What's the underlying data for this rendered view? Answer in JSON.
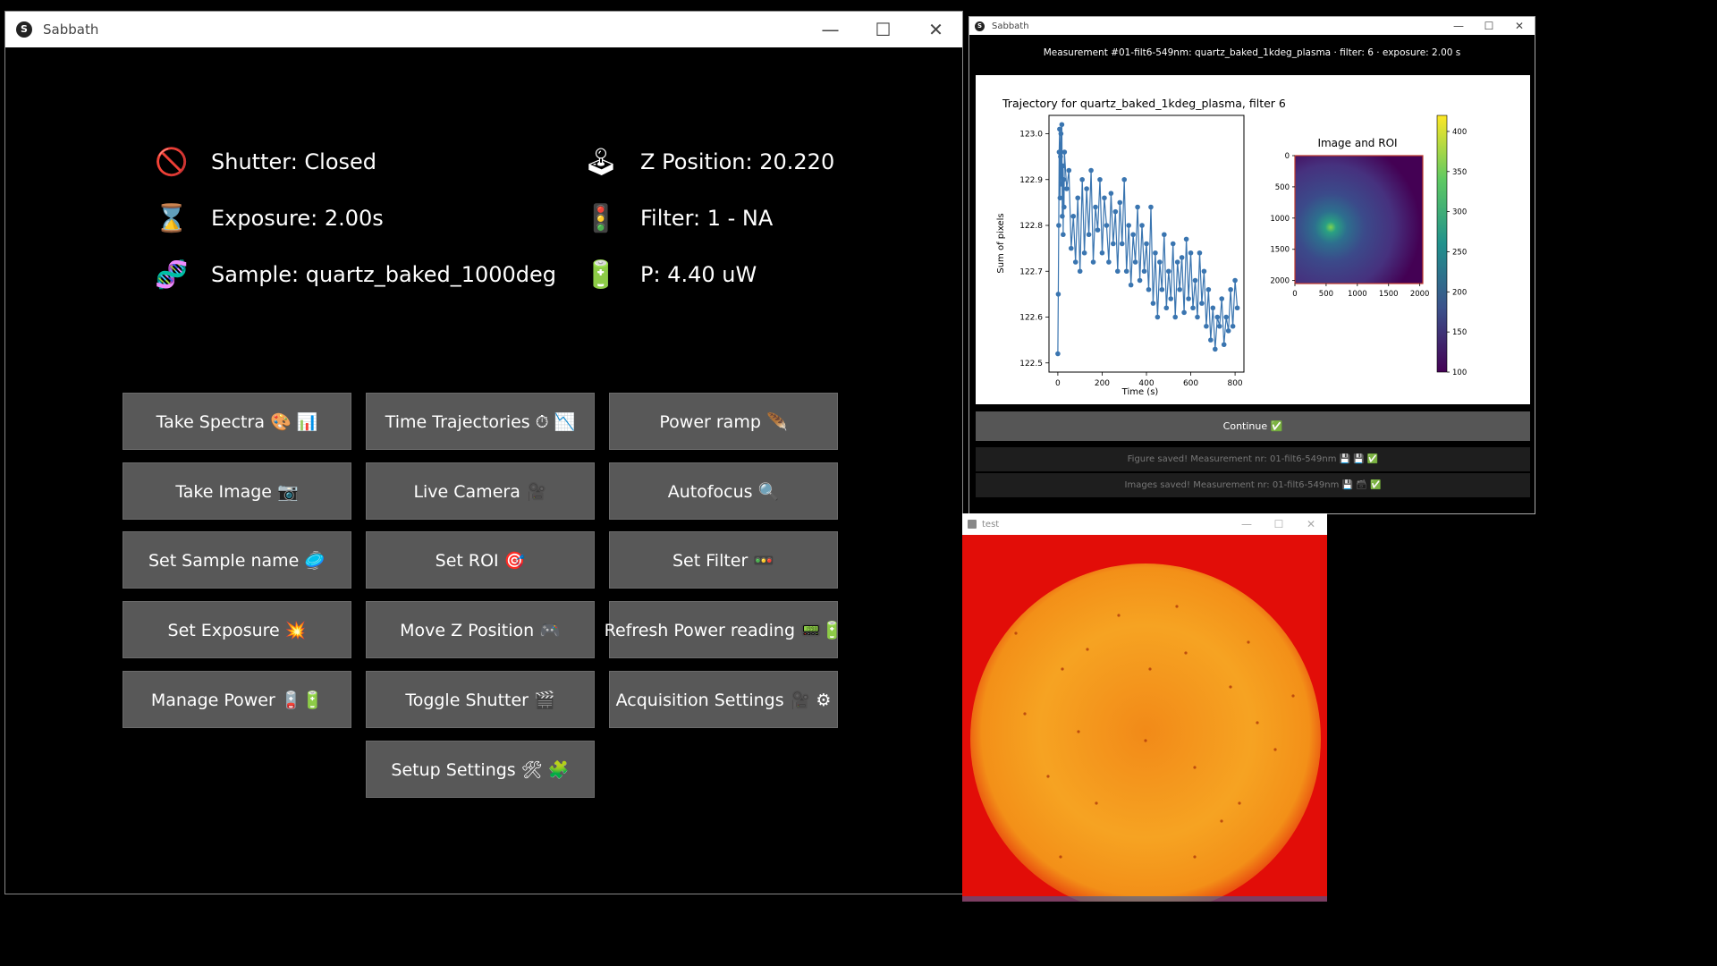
{
  "main": {
    "title": "Sabbath",
    "controls": [
      "—",
      "☐",
      "✕"
    ],
    "status": {
      "shutter": {
        "icon": "no-entry-icon",
        "glyph": "🚫",
        "text": "Shutter: Closed"
      },
      "exposure": {
        "icon": "hourglass-icon",
        "glyph": "⌛",
        "text": "Exposure: 2.00s"
      },
      "sample": {
        "icon": "dna-icon",
        "glyph": "🧬",
        "text": "Sample: quartz_baked_1000deg"
      },
      "zpos": {
        "icon": "joystick-icon",
        "glyph": "🕹",
        "text": "Z Position: 20.220"
      },
      "filter": {
        "icon": "traffic-light-icon",
        "glyph": "🚦",
        "text": "Filter: 1 - NA"
      },
      "power": {
        "icon": "battery-icon",
        "glyph": "🔋",
        "text": "P: 4.40 uW"
      }
    },
    "buttons": [
      "Take Spectra 🎨 📊",
      "Time Trajectories ⏱ 📉",
      "Power ramp 🪶",
      "Take Image 📷",
      "Live Camera 🎥",
      "Autofocus 🔍",
      "Set Sample name 🥏",
      "Set ROI 🎯",
      "Set Filter 🚥",
      "Set Exposure 💥",
      "Move Z Position 🎮",
      "Refresh Power reading 📟🔋",
      "Manage Power 🪫🔋",
      "Toggle Shutter 🎬",
      "Acquisition Settings 🎥 ⚙",
      "Setup Settings 🛠 🧩"
    ]
  },
  "plot": {
    "title": "Sabbath",
    "controls": [
      "—",
      "☐",
      "✕"
    ],
    "measurement": "Measurement #01-filt6-549nm: quartz_baked_1kdeg_plasma · filter: 6 · exposure: 2.00 s",
    "continue_label": "Continue ✅",
    "saved": [
      "Figure saved! Measurement nr: 01-filt6-549nm 💾 💾 ✅",
      "Images saved! Measurement nr: 01-filt6-549nm 💾 🗃 ✅"
    ]
  },
  "chart_data": [
    {
      "type": "line",
      "title": "Trajectory for quartz_baked_1kdeg_plasma, filter 6",
      "xlabel": "Time (s)",
      "ylabel": "Sum of pixels",
      "xlim": [
        -40,
        840
      ],
      "ylim": [
        122.48,
        123.04
      ],
      "xticks": [
        0,
        200,
        400,
        600,
        800
      ],
      "yticks": [
        122.5,
        122.6,
        122.7,
        122.8,
        122.9,
        123.0
      ],
      "ytick_labels": [
        "122.5",
        "122.6",
        "122.7",
        "122.8",
        "122.9",
        "123.0"
      ],
      "color": "#3a75b0",
      "x": [
        0,
        2,
        4,
        6,
        8,
        10,
        12,
        14,
        16,
        18,
        20,
        22,
        24,
        26,
        28,
        30,
        40,
        50,
        60,
        70,
        80,
        90,
        100,
        110,
        120,
        130,
        140,
        150,
        160,
        170,
        180,
        190,
        200,
        210,
        220,
        230,
        240,
        250,
        260,
        270,
        280,
        290,
        300,
        310,
        320,
        330,
        340,
        350,
        360,
        370,
        380,
        390,
        400,
        410,
        420,
        430,
        440,
        450,
        460,
        470,
        480,
        490,
        500,
        510,
        520,
        530,
        540,
        550,
        560,
        570,
        580,
        590,
        600,
        610,
        620,
        630,
        640,
        650,
        660,
        670,
        680,
        690,
        700,
        710,
        720,
        730,
        740,
        750,
        760,
        770,
        780,
        790,
        800,
        810
      ],
      "y": [
        122.52,
        122.65,
        122.8,
        122.96,
        123.01,
        122.86,
        122.95,
        123.0,
        122.89,
        123.02,
        122.82,
        122.93,
        122.78,
        122.9,
        122.84,
        122.96,
        122.88,
        122.92,
        122.75,
        122.82,
        122.72,
        122.86,
        122.7,
        122.9,
        122.74,
        122.88,
        122.78,
        122.92,
        122.72,
        122.84,
        122.79,
        122.9,
        122.74,
        122.86,
        122.8,
        122.72,
        122.87,
        122.76,
        122.83,
        122.7,
        122.85,
        122.76,
        122.9,
        122.7,
        122.8,
        122.67,
        122.78,
        122.72,
        122.84,
        122.68,
        122.8,
        122.7,
        122.76,
        122.66,
        122.84,
        122.63,
        122.74,
        122.6,
        122.72,
        122.66,
        122.78,
        122.62,
        122.7,
        122.64,
        122.76,
        122.6,
        122.72,
        122.66,
        122.73,
        122.61,
        122.77,
        122.64,
        122.74,
        122.62,
        122.68,
        122.6,
        122.74,
        122.63,
        122.7,
        122.58,
        122.66,
        122.55,
        122.62,
        122.53,
        122.6,
        122.58,
        122.64,
        122.54,
        122.6,
        122.57,
        122.66,
        122.58,
        122.68,
        122.62
      ]
    },
    {
      "type": "heatmap",
      "title": "Image and ROI",
      "xticks": [
        0,
        500,
        1000,
        1500,
        2000
      ],
      "yticks": [
        0,
        500,
        1000,
        1500,
        2000
      ],
      "xlim": [
        0,
        2048
      ],
      "ylim": [
        2048,
        0
      ],
      "colorbar_ticks": [
        100,
        150,
        200,
        250,
        300,
        350,
        400
      ],
      "colorbar_range": [
        100,
        420
      ],
      "roi_color": "#c0392b"
    }
  ]
}
